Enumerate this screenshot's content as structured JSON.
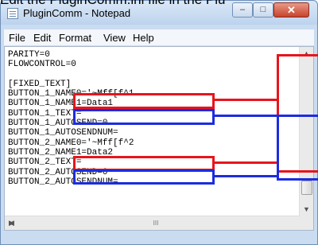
{
  "caption": "Edit the PluginComm.ini file in the Plu",
  "window": {
    "title": "PluginComm - Notepad",
    "minimize_glyph": "–",
    "maximize_glyph": "□",
    "close_glyph": "✕"
  },
  "menu": [
    "File",
    "Edit",
    "Format",
    "View",
    "Help"
  ],
  "editor": {
    "content": "PARITY=0\nFLOWCONTROL=0\n\n[FIXED_TEXT]\nBUTTON_1_NAME0='~Mff[f^1\nBUTTON_1_NAME1=Data1\nBUTTON_1_TEXT=\nBUTTON_1_AUTOSEND=0\nBUTTON_1_AUTOSENDNUM=\nBUTTON_2_NAME0='~Mff[f^2\nBUTTON_2_NAME1=Data2\nBUTTON_2_TEXT=\nBUTTON_2_AUTOSEND=0\nBUTTON_2_AUTOSENDNUM="
  },
  "scrollbar": {
    "up_glyph": "▲",
    "down_glyph": "▼",
    "left_glyph": "◀",
    "right_glyph": "▶",
    "thumb_glyph": "III"
  },
  "colors": {
    "red_highlight": "#e8141c",
    "blue_highlight": "#1c2ce0"
  }
}
